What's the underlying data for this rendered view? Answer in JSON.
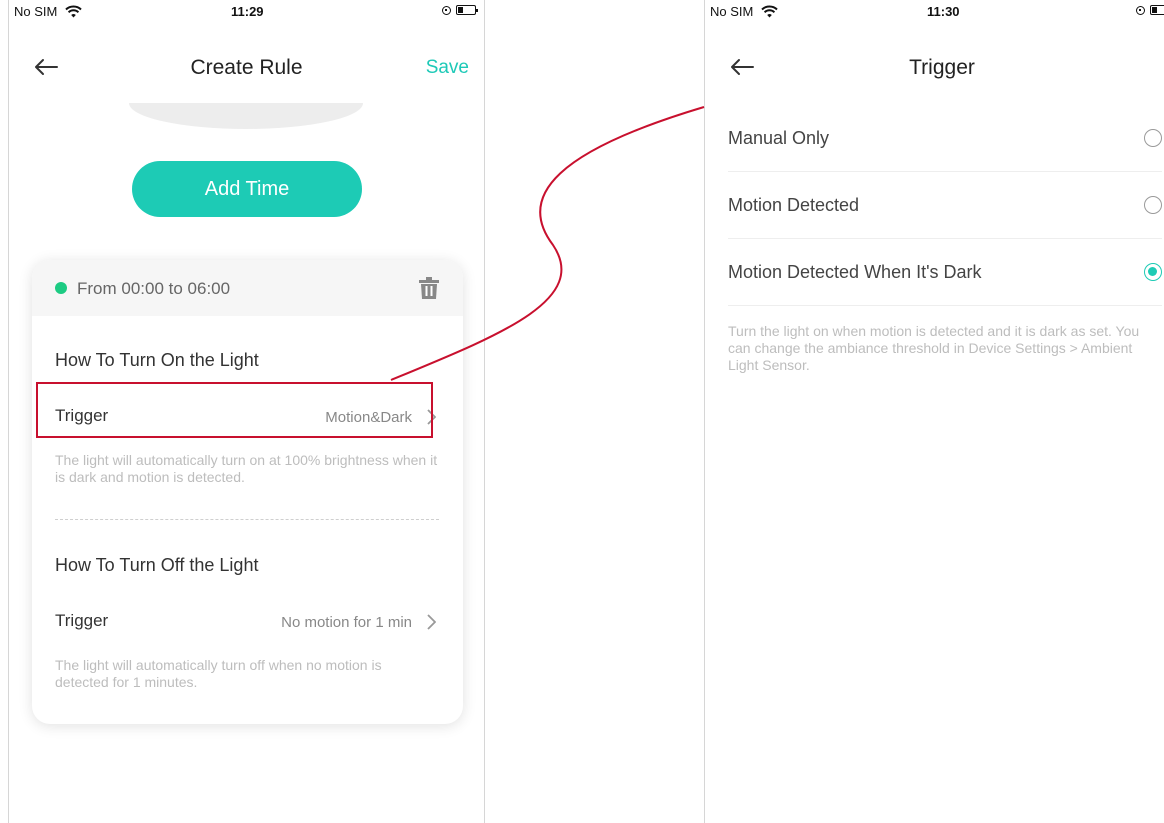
{
  "left": {
    "status": {
      "carrier": "No SIM",
      "time": "11:29"
    },
    "header": {
      "title": "Create Rule",
      "save_label": "Save"
    },
    "add_time_label": "Add Time",
    "rule": {
      "time_range": "From 00:00 to 06:00",
      "on_section": {
        "title": "How To Turn On the Light",
        "trigger_label": "Trigger",
        "trigger_value": "Motion&Dark",
        "hint": "The light will automatically turn on at 100% brightness when it is dark and motion is detected."
      },
      "off_section": {
        "title": "How To Turn Off the Light",
        "trigger_label": "Trigger",
        "trigger_value": "No motion for 1 min",
        "hint": "The light will automatically turn off when no motion is detected for 1 minutes."
      }
    }
  },
  "right": {
    "status": {
      "carrier": "No SIM",
      "time": "11:30"
    },
    "header": {
      "title": "Trigger"
    },
    "options": [
      {
        "label": "Manual Only",
        "selected": false
      },
      {
        "label": "Motion Detected",
        "selected": false
      },
      {
        "label": "Motion Detected When It's Dark",
        "selected": true
      }
    ],
    "description": "Turn the light on when motion is detected and it is dark as set. You can change the ambiance threshold in Device Settings > Ambient Light Sensor."
  },
  "colors": {
    "accent": "#1dcbb5",
    "status_dot": "#1dcb83",
    "highlight": "#c8102e",
    "hint_text": "#bdbdbd"
  },
  "icons": [
    "wifi-icon",
    "rotation-lock-icon",
    "battery-icon",
    "back-arrow-icon",
    "trash-icon",
    "chevron-right-icon"
  ]
}
